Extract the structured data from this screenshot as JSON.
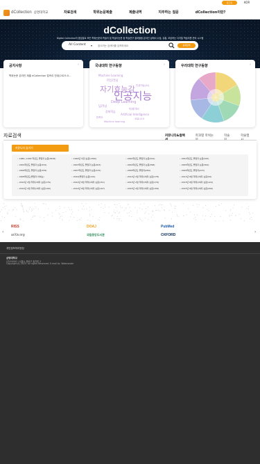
{
  "topbar": {
    "login_label": "로그인",
    "language": "KOR"
  },
  "header": {
    "logo_text": "dCollection",
    "university": "삼명대학교",
    "nav": [
      "자료검색",
      "학위논문제출",
      "제출내역",
      "지주하는 질문",
      "dCollection이란?"
    ]
  },
  "hero": {
    "title": "dCollection",
    "description": "Digital Collection의 줄임말로 모든 학위논문과 학술지 및 학술지논문 등 학술연구 결과물을 온라인 상에서 수집, 유통, 보존하는 디지털 학술자원 관리 시스템",
    "search_scope": "All Content",
    "search_placeholder": "찾으려는 검색어를 입력하세요",
    "advanced_label": "상세검색"
  },
  "cards": [
    {
      "title": "공지사항",
      "notice": "학위논문 온라인 제출 dCollection 접속이 안내(2025.0..."
    },
    {
      "title": "국내대학 연구동향"
    },
    {
      "title": "우리대학 연구동향"
    }
  ],
  "wordcloud": [
    "인공지능",
    "자기효능감",
    "Deep Learning",
    "Machine Learning",
    "딥러닝",
    "머신러닝",
    "Artificial Intelligence",
    "강화학습",
    "빅데이터",
    "만족도",
    "코로나19",
    "Machine learning",
    "인공지능(AI)"
  ],
  "section": {
    "title": "자료검색",
    "tabs": [
      "커뮤니티&컬렉션",
      "학과별 학위논문",
      "학술지",
      "학술행사"
    ],
    "collapse_label": "커뮤니티 숨기기"
  },
  "collections": [
    "1980~1999 학년도 졸업자 논문(3636)",
    "1990년 이전 논문(1360)",
    "2000학년도 졸업자 논문(324)",
    "2001학년도 졸업자 논문(325)",
    "2002학년도 졸업자 논문(432)",
    "2003학년도 졸업자 논문(463)",
    "2004학년도 졸업자 논문(398)",
    "2005학년도 졸업자 논문(364)",
    "2006학년도 졸업자 논문(339)",
    "2007학년도 졸업자 논문(315)",
    "2008학년도 졸업자(284)",
    "2009학년도 졸업자(215)",
    "2008학년도(졸업자 이하는)",
    "2010(졸업자 논문(219)",
    "2011년 2월 학위수여자 논문(178)",
    "2011년 8월 학위수여자 논문(94)",
    "2012년 2월 학위수여자 논문(176)",
    "2012년 8월 학위수여자 논문(151)",
    "2013년 2월 학위수여자 논문(176)",
    "2013년 8월 학위수여자 논문(124)",
    "2014년 2월 학위수여자 논문(190)",
    "2014년 8월 학위수여자 논문(197)",
    "2015년 2월 학위수여자 논문(158)",
    "2015년 8월 학위수여자 논문(206)"
  ],
  "partners": [
    "RISS",
    "DOAJ",
    "PubMed",
    "arXiv.org",
    "국립중앙도서관",
    "OXFORD"
  ],
  "footer": {
    "policy": "개인정보처리방침",
    "name": "삼명대학교",
    "address": "(우)00000 | 서울시 종로구 홍지문 2",
    "copyright": "Copyright(c) 2025. All rights Reserved. E-mail to: Webmaster"
  },
  "colors": {
    "accent": "#f39c12",
    "hero_bg": "#0c1b2e",
    "footer_bg": "#2e2e2e"
  }
}
